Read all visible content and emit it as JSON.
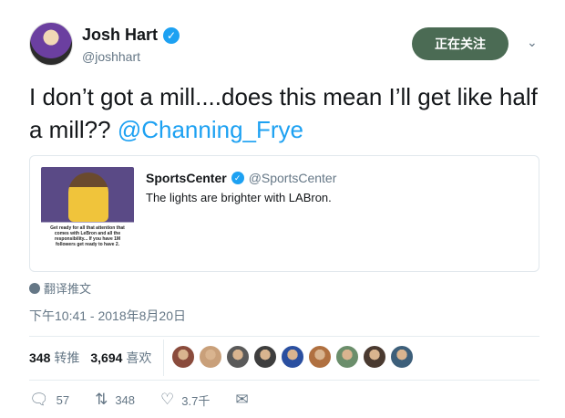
{
  "author": {
    "display_name": "Josh Hart",
    "handle": "@joshhart",
    "verified_icon": "verified-badge-icon"
  },
  "follow_button_label": "正在关注",
  "tweet": {
    "text_before": "I don’t got a mill....does this mean I’ll get like half a mill?? ",
    "mention": "@Channing_Frye"
  },
  "quoted": {
    "name": "SportsCenter",
    "handle": "@SportsCenter",
    "text": "The lights are brighter with LABron.",
    "image_caption": "Get ready for all that attention that comes with LeBron and all the responsibility... If you have 1M followers get ready to have 2."
  },
  "translate_label": "翻译推文",
  "timestamp": "下午10:41 - 2018年8月20日",
  "stats": {
    "retweets_count": "348",
    "retweets_label": "转推",
    "likes_count": "3,694",
    "likes_label": "喜欢"
  },
  "likers_faces": [
    "#8a4b3c",
    "#c9a07a",
    "#5a5a5a",
    "#3e3e3e",
    "#2a4fa0",
    "#b07040",
    "#6b8e6b",
    "#4a3a30",
    "#3d5f7a"
  ],
  "actions": {
    "replies": "57",
    "retweets": "348",
    "likes": "3.7千"
  },
  "colors": {
    "accent": "#1da1f2",
    "follow_bg": "#4b6b54",
    "secondary_text": "#657786"
  }
}
